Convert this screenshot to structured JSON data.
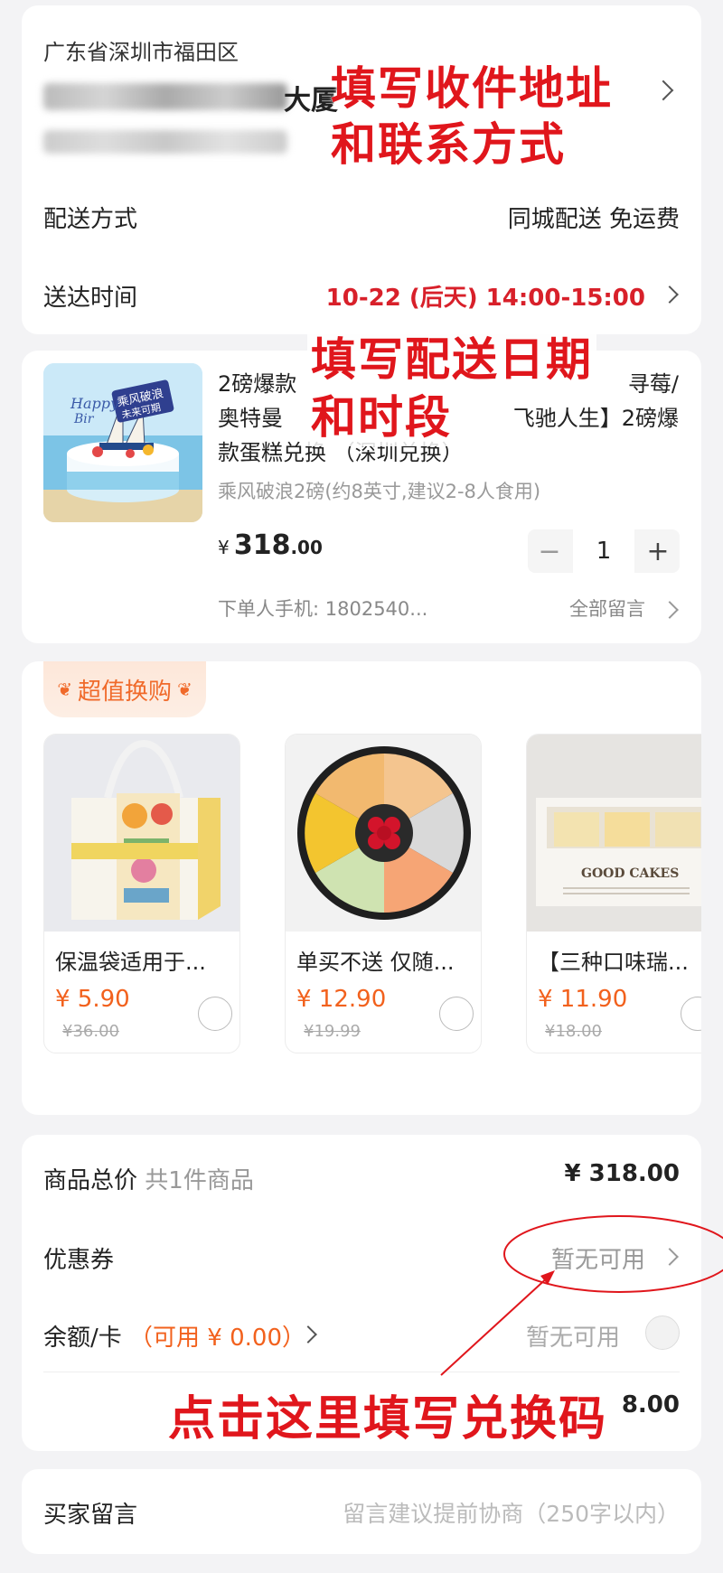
{
  "address": {
    "region": "广东省深圳市福田区",
    "building_suffix": "大厦"
  },
  "delivery": {
    "method_label": "配送方式",
    "method_value": "同城配送 免运费",
    "time_label": "送达时间",
    "time_value": "10-22 (后天) 14:00-15:00"
  },
  "product": {
    "title": "2磅爆款蛋糕兑换【乘风破浪/冬日寻莓/奥特曼/飞驰人生】2磅爆款蛋糕兑换 （深圳兑换）",
    "title_line1": "2磅爆款",
    "title_line1_end": "寻莓/",
    "title_line2": "奥特曼",
    "title_line2_end": "飞驰人生】2磅爆",
    "title_line3": "款蛋糕兑换 （深圳兑换）",
    "spec": "乘风破浪2磅(约8英寸,建议2-8人食用)",
    "price_symbol": "¥",
    "price_int": "318",
    "price_dec": ".00",
    "quantity": "1",
    "minus": "−",
    "plus": "+",
    "buyer_phone": "下单人手机: 1802540...",
    "all_notes": "全部留言"
  },
  "exchange": {
    "badge": "超值换购",
    "items": [
      {
        "name": "保温袋适用于...",
        "price": "¥ 5.90",
        "original": "¥36.00"
      },
      {
        "name": "单买不送 仅随...",
        "price": "¥ 12.90",
        "original": "¥19.99"
      },
      {
        "name": "【三种口味瑞...",
        "price": "¥ 11.90",
        "original": "¥18.00"
      }
    ],
    "box_brand": "GOOD CAKES"
  },
  "summary": {
    "total_label": "商品总价",
    "total_count": "共1件商品",
    "total_value": "¥ 318.00",
    "coupon_label": "优惠券",
    "coupon_value": "暂无可用",
    "balance_label": "余额/卡",
    "balance_available": "（可用 ¥ 0.00）",
    "balance_value": "暂无可用",
    "hidden_total_value": "8.00"
  },
  "remark": {
    "label": "买家留言",
    "placeholder": "留言建议提前协商（250字以内）"
  },
  "annotations": {
    "fill_address": "填写收件地址",
    "fill_contact": "和联系方式",
    "fill_date": "填写配送日期",
    "fill_slot": "和时段",
    "fill_code": "点击这里填写兑换码"
  },
  "colors": {
    "accent_red": "#e0161c",
    "price_orange": "#f2611d",
    "time_red": "#d8202a"
  }
}
